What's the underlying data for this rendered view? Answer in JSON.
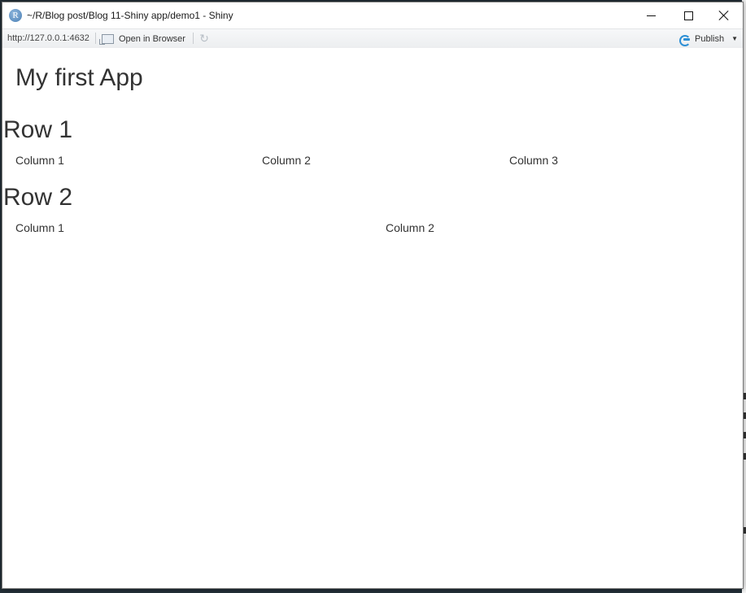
{
  "window": {
    "title": "~/R/Blog post/Blog 11-Shiny app/demo1 - Shiny",
    "app_icon_letter": "R"
  },
  "toolbar": {
    "url": "http://127.0.0.1:4632",
    "open_in_browser_label": "Open in Browser",
    "publish_label": "Publish"
  },
  "app": {
    "title": "My first App",
    "rows": [
      {
        "heading": "Row 1",
        "columns": [
          "Column 1",
          "Column 2",
          "Column 3"
        ]
      },
      {
        "heading": "Row 2",
        "columns": [
          "Column 1",
          "Column 2"
        ]
      }
    ]
  },
  "icons": {
    "app": "r-logo-icon",
    "minimize": "minimize-icon",
    "maximize": "maximize-icon",
    "close": "close-icon",
    "open_browser": "browser-window-icon",
    "refresh": "refresh-icon",
    "publish": "publish-icon",
    "dropdown": "chevron-down-icon"
  }
}
